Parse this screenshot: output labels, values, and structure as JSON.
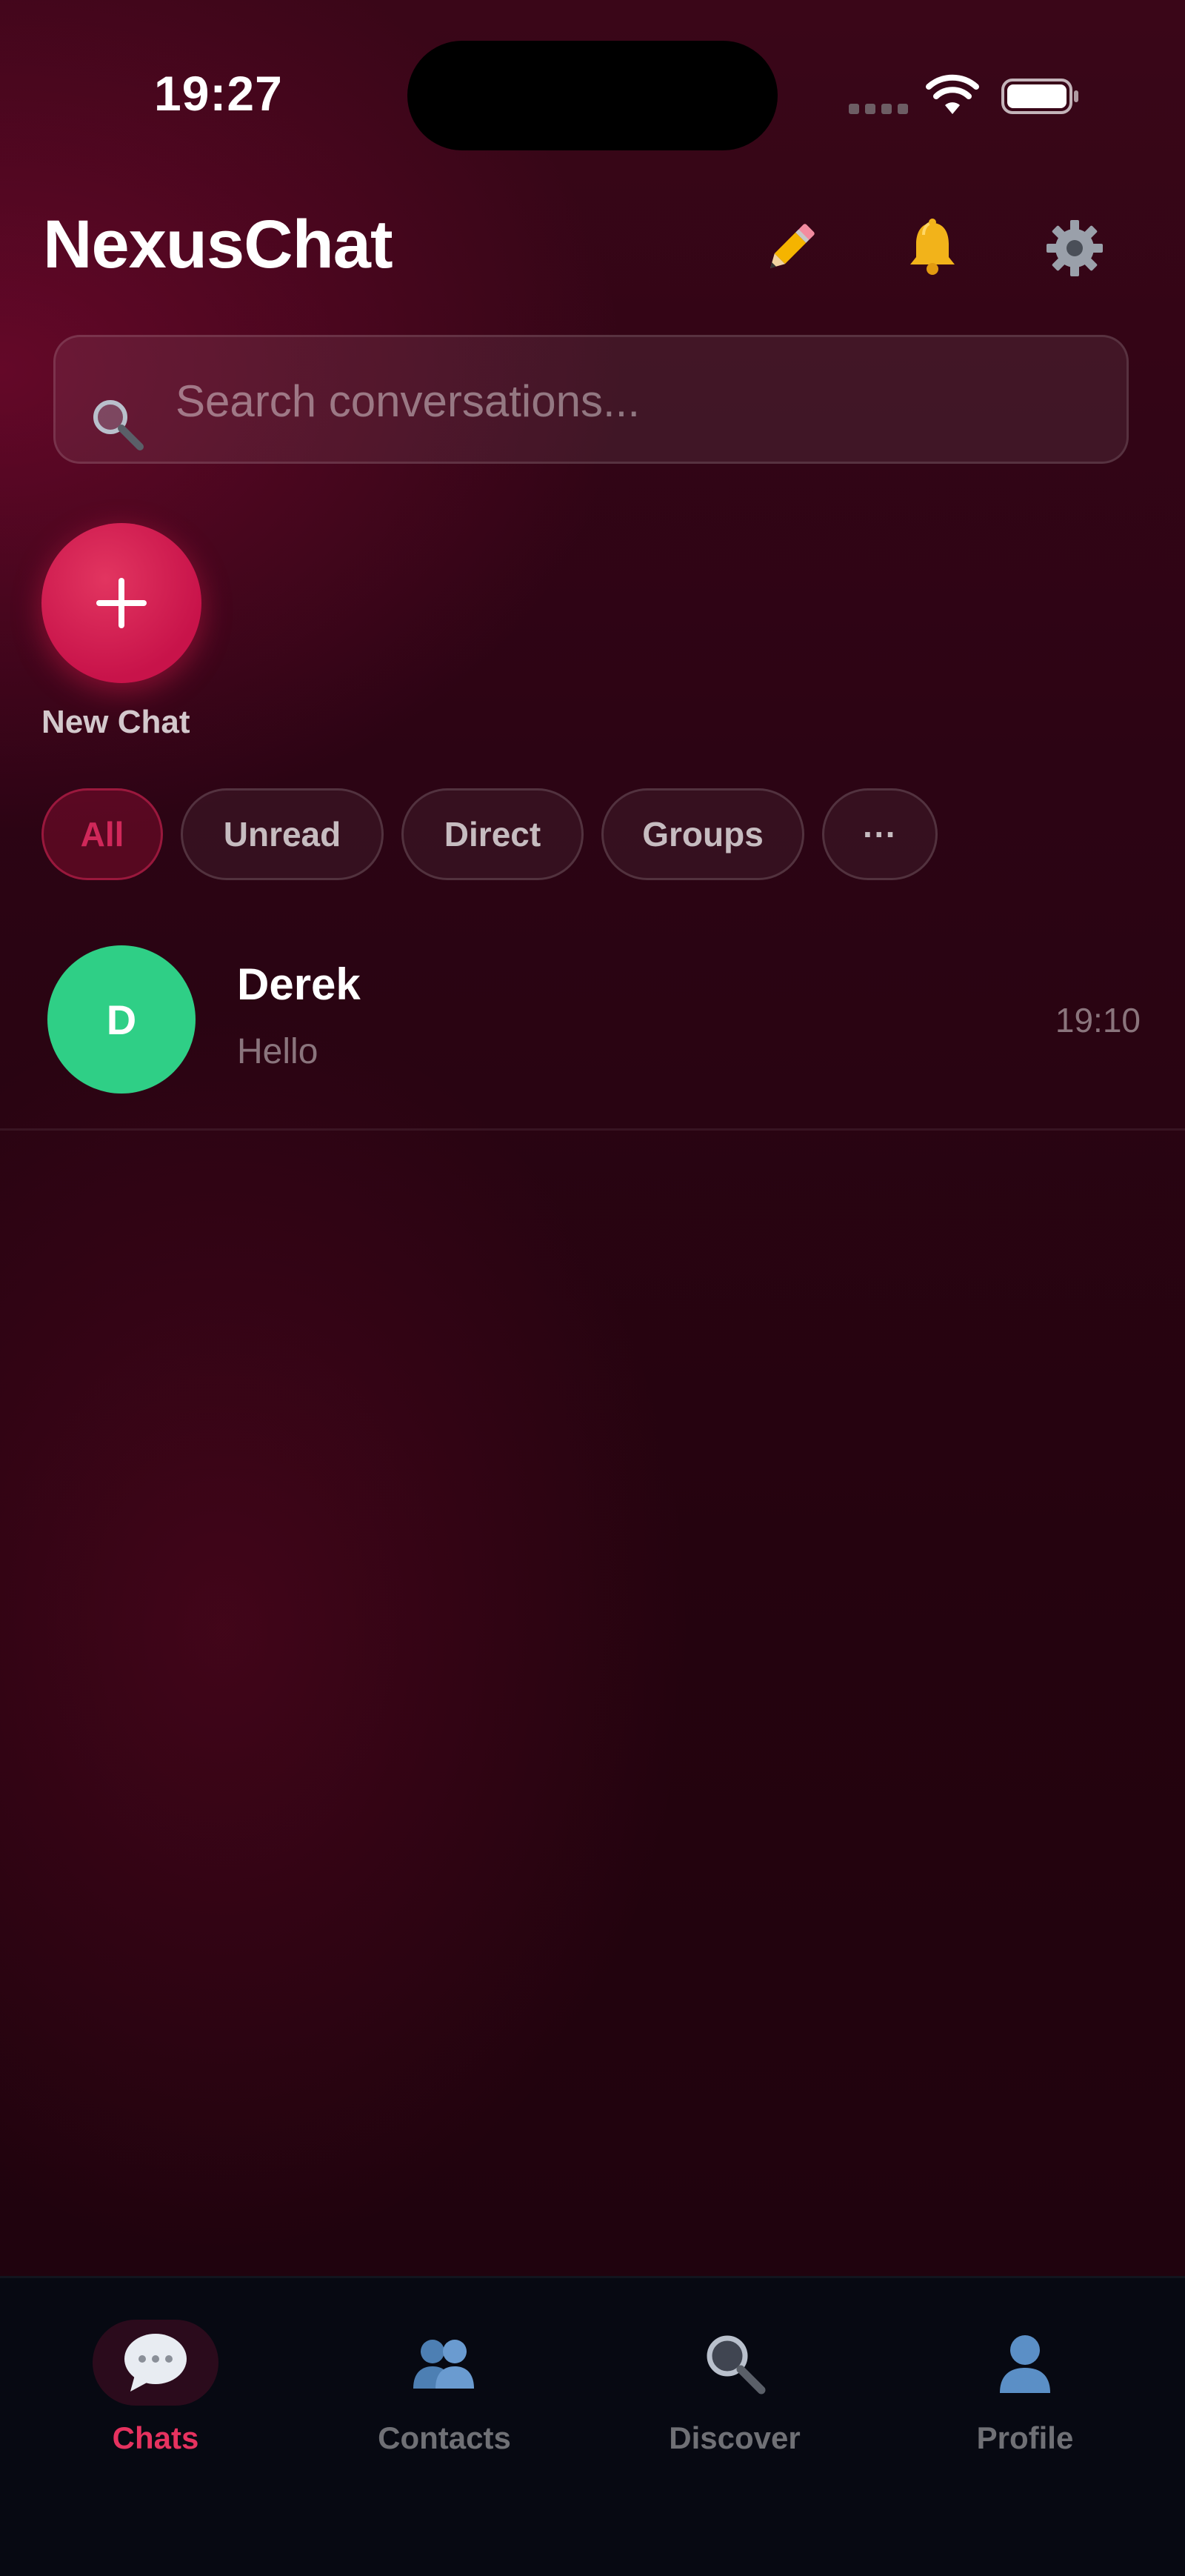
{
  "status_bar": {
    "time": "19:27"
  },
  "header": {
    "title": "NexusChat",
    "icons": [
      "pencil-icon",
      "bell-icon",
      "gear-icon"
    ]
  },
  "search": {
    "placeholder": "Search conversations...",
    "value": ""
  },
  "new_chat": {
    "label": "New Chat"
  },
  "filters": {
    "items": [
      "All",
      "Unread",
      "Direct",
      "Groups",
      "···"
    ],
    "active": "All"
  },
  "conversations": [
    {
      "initial": "D",
      "name": "Derek",
      "preview": "Hello",
      "time": "19:10",
      "avatar_color": "#2fcf86"
    }
  ],
  "bottom_nav": {
    "items": [
      {
        "label": "Chats",
        "icon": "chat-bubble-icon"
      },
      {
        "label": "Contacts",
        "icon": "people-icon"
      },
      {
        "label": "Discover",
        "icon": "magnifier-icon"
      },
      {
        "label": "Profile",
        "icon": "person-icon"
      }
    ],
    "active": "Chats"
  },
  "colors": {
    "accent": "#e6325f",
    "background": "#2c0414",
    "nav_background": "#070912"
  }
}
